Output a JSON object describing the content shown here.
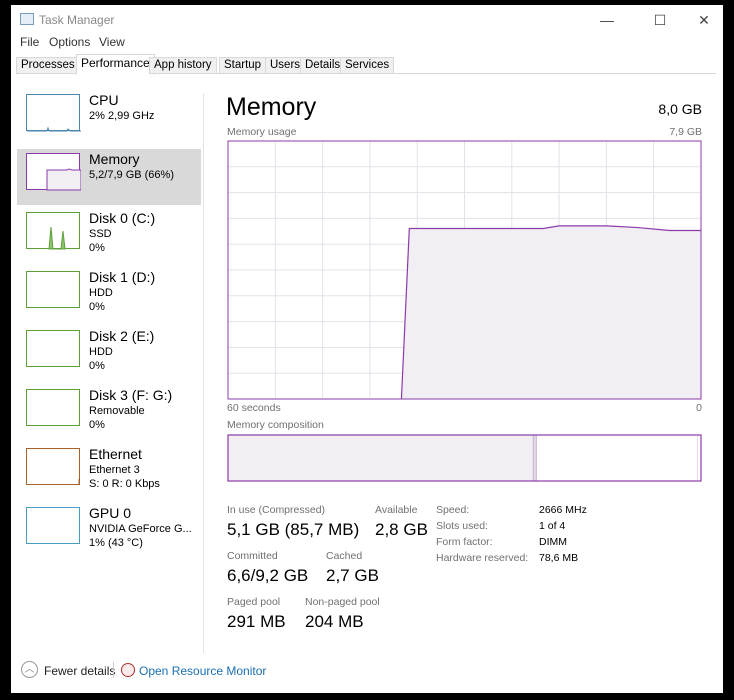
{
  "window": {
    "title": "Task Manager",
    "minimize": "—",
    "maximize": "☐",
    "close": "✕"
  },
  "menu": [
    "File",
    "Options",
    "View"
  ],
  "tabs": [
    "Processes",
    "Performance",
    "App history",
    "Startup",
    "Users",
    "Details",
    "Services"
  ],
  "active_tab": "Performance",
  "sidebar": [
    {
      "name": "CPU",
      "line1": "2% 2,99 GHz",
      "line2": "",
      "color": "#4a87b0"
    },
    {
      "name": "Memory",
      "line1": "5,2/7,9 GB (66%)",
      "line2": "",
      "color": "#8b3aa8",
      "selected": true
    },
    {
      "name": "Disk 0 (C:)",
      "line1": "SSD",
      "line2": "0%",
      "color": "#5ca03a"
    },
    {
      "name": "Disk 1 (D:)",
      "line1": "HDD",
      "line2": "0%",
      "color": "#5ca03a"
    },
    {
      "name": "Disk 2 (E:)",
      "line1": "HDD",
      "line2": "0%",
      "color": "#5ca03a"
    },
    {
      "name": "Disk 3 (F: G:)",
      "line1": "Removable",
      "line2": "0%",
      "color": "#5ca03a"
    },
    {
      "name": "Ethernet",
      "line1": "Ethernet 3",
      "line2": "S: 0 R: 0 Kbps",
      "color": "#a7622a"
    },
    {
      "name": "GPU 0",
      "line1": "NVIDIA GeForce G...",
      "line2": "1%  (43 °C)",
      "color": "#4a9cc0"
    }
  ],
  "main": {
    "title": "Memory",
    "total": "8,0 GB",
    "usage_label": "Memory usage",
    "usage_max": "7,9 GB",
    "time_left": "60 seconds",
    "time_right": "0",
    "composition_label": "Memory composition",
    "stats": {
      "in_use_label": "In use (Compressed)",
      "in_use": "5,1 GB (85,7 MB)",
      "available_label": "Available",
      "available": "2,8 GB",
      "committed_label": "Committed",
      "committed": "6,6/9,2 GB",
      "cached_label": "Cached",
      "cached": "2,7 GB",
      "paged_label": "Paged pool",
      "paged": "291 MB",
      "nonpaged_label": "Non-paged pool",
      "nonpaged": "204 MB"
    },
    "details": [
      {
        "k": "Speed:",
        "v": "2666 MHz"
      },
      {
        "k": "Slots used:",
        "v": "1 of 4"
      },
      {
        "k": "Form factor:",
        "v": "DIMM"
      },
      {
        "k": "Hardware reserved:",
        "v": "78,6 MB"
      }
    ]
  },
  "footer": {
    "fewer": "Fewer details",
    "monitor": "Open Resource Monitor"
  },
  "chart_data": {
    "type": "area",
    "title": "Memory usage",
    "xlabel": "seconds ago",
    "ylabel": "GB",
    "xlim": [
      60,
      0
    ],
    "ylim": [
      0,
      7.9
    ],
    "grid": true,
    "x": [
      38,
      37,
      30,
      20,
      18,
      12,
      8,
      4,
      0
    ],
    "values": [
      0,
      5.22,
      5.22,
      5.22,
      5.3,
      5.3,
      5.25,
      5.16,
      5.16
    ],
    "composition": {
      "in_use": 5.1,
      "modified": 0.05,
      "standby": 2.7,
      "free": 0.1,
      "total": 7.9
    },
    "color": "#8b3aa8",
    "fill": "#f2eff4"
  }
}
